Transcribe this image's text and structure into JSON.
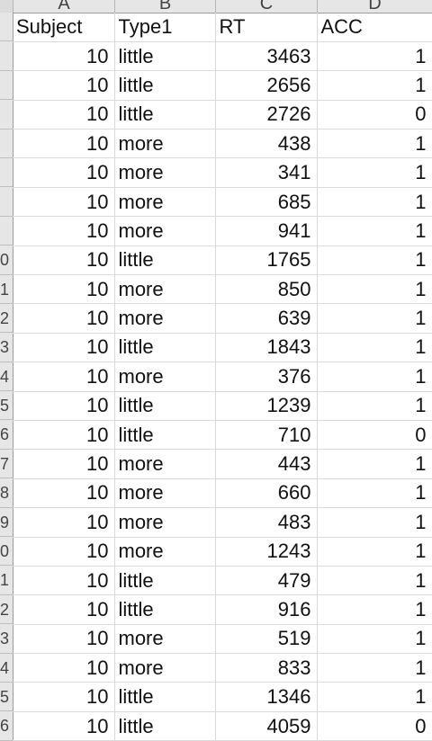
{
  "columns": [
    "A",
    "B",
    "C",
    "D"
  ],
  "row_numbers": [
    "",
    "",
    "",
    "",
    "",
    "",
    "",
    "",
    "0",
    "1",
    "2",
    "3",
    "4",
    "5",
    "6",
    "7",
    "8",
    "9",
    "0",
    "1",
    "2",
    "3",
    "4",
    "5",
    "6"
  ],
  "header": {
    "subject": "Subject",
    "type1": "Type1",
    "rt": "RT",
    "acc": "ACC"
  },
  "rows": [
    {
      "subject": "10",
      "type1": "little",
      "rt": "3463",
      "acc": "1"
    },
    {
      "subject": "10",
      "type1": "little",
      "rt": "2656",
      "acc": "1"
    },
    {
      "subject": "10",
      "type1": "little",
      "rt": "2726",
      "acc": "0"
    },
    {
      "subject": "10",
      "type1": "more",
      "rt": "438",
      "acc": "1"
    },
    {
      "subject": "10",
      "type1": "more",
      "rt": "341",
      "acc": "1"
    },
    {
      "subject": "10",
      "type1": "more",
      "rt": "685",
      "acc": "1"
    },
    {
      "subject": "10",
      "type1": "more",
      "rt": "941",
      "acc": "1"
    },
    {
      "subject": "10",
      "type1": "little",
      "rt": "1765",
      "acc": "1"
    },
    {
      "subject": "10",
      "type1": "more",
      "rt": "850",
      "acc": "1"
    },
    {
      "subject": "10",
      "type1": "more",
      "rt": "639",
      "acc": "1"
    },
    {
      "subject": "10",
      "type1": "little",
      "rt": "1843",
      "acc": "1"
    },
    {
      "subject": "10",
      "type1": "more",
      "rt": "376",
      "acc": "1"
    },
    {
      "subject": "10",
      "type1": "little",
      "rt": "1239",
      "acc": "1"
    },
    {
      "subject": "10",
      "type1": "little",
      "rt": "710",
      "acc": "0"
    },
    {
      "subject": "10",
      "type1": "more",
      "rt": "443",
      "acc": "1"
    },
    {
      "subject": "10",
      "type1": "more",
      "rt": "660",
      "acc": "1"
    },
    {
      "subject": "10",
      "type1": "more",
      "rt": "483",
      "acc": "1"
    },
    {
      "subject": "10",
      "type1": "more",
      "rt": "1243",
      "acc": "1"
    },
    {
      "subject": "10",
      "type1": "little",
      "rt": "479",
      "acc": "1"
    },
    {
      "subject": "10",
      "type1": "little",
      "rt": "916",
      "acc": "1"
    },
    {
      "subject": "10",
      "type1": "more",
      "rt": "519",
      "acc": "1"
    },
    {
      "subject": "10",
      "type1": "more",
      "rt": "833",
      "acc": "1"
    },
    {
      "subject": "10",
      "type1": "little",
      "rt": "1346",
      "acc": "1"
    },
    {
      "subject": "10",
      "type1": "little",
      "rt": "4059",
      "acc": "0"
    }
  ]
}
